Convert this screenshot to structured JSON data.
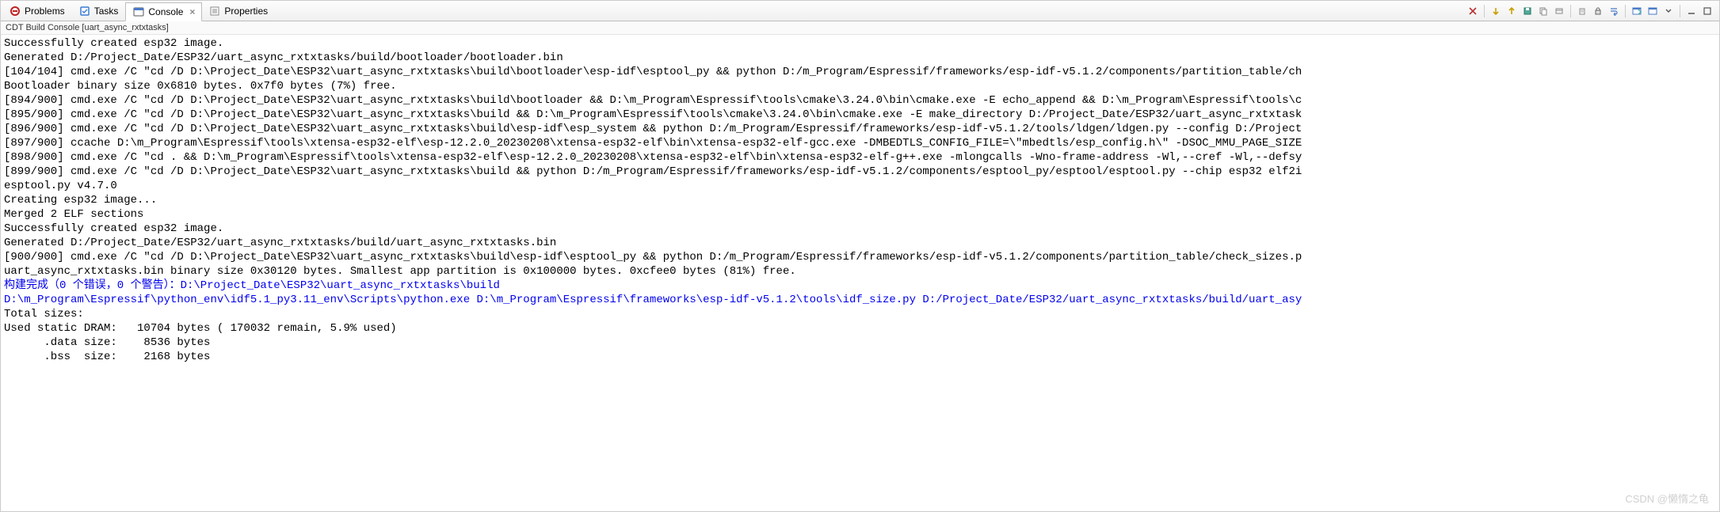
{
  "tabs": {
    "problems": "Problems",
    "tasks": "Tasks",
    "console": "Console",
    "properties": "Properties"
  },
  "subtitle": "CDT Build Console [uart_async_rxtxtasks]",
  "toolbar": {
    "close": "×",
    "arrow_down": "⇩",
    "arrow_up": "⇧",
    "pin": "📌",
    "sync": "🔄",
    "clear": "🧹",
    "scroll_lock": "🔒",
    "wrap": "↩",
    "open": "📂",
    "terminal": "🖥",
    "new": "➕",
    "dropdown": "▾",
    "min": "—",
    "max": "▢"
  },
  "console_lines": [
    {
      "t": "Successfully created esp32 image.",
      "c": ""
    },
    {
      "t": "Generated D:/Project_Date/ESP32/uart_async_rxtxtasks/build/bootloader/bootloader.bin",
      "c": ""
    },
    {
      "t": "[104/104] cmd.exe /C \"cd /D D:\\Project_Date\\ESP32\\uart_async_rxtxtasks\\build\\bootloader\\esp-idf\\esptool_py && python D:/m_Program/Espressif/frameworks/esp-idf-v5.1.2/components/partition_table/ch",
      "c": ""
    },
    {
      "t": "Bootloader binary size 0x6810 bytes. 0x7f0 bytes (7%) free.",
      "c": ""
    },
    {
      "t": "[894/900] cmd.exe /C \"cd /D D:\\Project_Date\\ESP32\\uart_async_rxtxtasks\\build\\bootloader && D:\\m_Program\\Espressif\\tools\\cmake\\3.24.0\\bin\\cmake.exe -E echo_append && D:\\m_Program\\Espressif\\tools\\c",
      "c": ""
    },
    {
      "t": "[895/900] cmd.exe /C \"cd /D D:\\Project_Date\\ESP32\\uart_async_rxtxtasks\\build && D:\\m_Program\\Espressif\\tools\\cmake\\3.24.0\\bin\\cmake.exe -E make_directory D:/Project_Date/ESP32/uart_async_rxtxtask",
      "c": ""
    },
    {
      "t": "[896/900] cmd.exe /C \"cd /D D:\\Project_Date\\ESP32\\uart_async_rxtxtasks\\build\\esp-idf\\esp_system && python D:/m_Program/Espressif/frameworks/esp-idf-v5.1.2/tools/ldgen/ldgen.py --config D:/Project",
      "c": ""
    },
    {
      "t": "[897/900] ccache D:\\m_Program\\Espressif\\tools\\xtensa-esp32-elf\\esp-12.2.0_20230208\\xtensa-esp32-elf\\bin\\xtensa-esp32-elf-gcc.exe -DMBEDTLS_CONFIG_FILE=\\\"mbedtls/esp_config.h\\\" -DSOC_MMU_PAGE_SIZE",
      "c": ""
    },
    {
      "t": "[898/900] cmd.exe /C \"cd . && D:\\m_Program\\Espressif\\tools\\xtensa-esp32-elf\\esp-12.2.0_20230208\\xtensa-esp32-elf\\bin\\xtensa-esp32-elf-g++.exe -mlongcalls -Wno-frame-address -Wl,--cref -Wl,--defsy",
      "c": ""
    },
    {
      "t": "[899/900] cmd.exe /C \"cd /D D:\\Project_Date\\ESP32\\uart_async_rxtxtasks\\build && python D:/m_Program/Espressif/frameworks/esp-idf-v5.1.2/components/esptool_py/esptool/esptool.py --chip esp32 elf2i",
      "c": ""
    },
    {
      "t": "esptool.py v4.7.0",
      "c": ""
    },
    {
      "t": "Creating esp32 image...",
      "c": ""
    },
    {
      "t": "Merged 2 ELF sections",
      "c": ""
    },
    {
      "t": "Successfully created esp32 image.",
      "c": ""
    },
    {
      "t": "Generated D:/Project_Date/ESP32/uart_async_rxtxtasks/build/uart_async_rxtxtasks.bin",
      "c": ""
    },
    {
      "t": "[900/900] cmd.exe /C \"cd /D D:\\Project_Date\\ESP32\\uart_async_rxtxtasks\\build\\esp-idf\\esptool_py && python D:/m_Program/Espressif/frameworks/esp-idf-v5.1.2/components/partition_table/check_sizes.p",
      "c": ""
    },
    {
      "t": "uart_async_rxtxtasks.bin binary size 0x30120 bytes. Smallest app partition is 0x100000 bytes. 0xcfee0 bytes (81%) free.",
      "c": ""
    },
    {
      "t": "构建完成（0 个错误，0 个警告）：D:\\Project_Date\\ESP32\\uart_async_rxtxtasks\\build",
      "c": "blue"
    },
    {
      "t": "D:\\m_Program\\Espressif\\python_env\\idf5.1_py3.11_env\\Scripts\\python.exe D:\\m_Program\\Espressif\\frameworks\\esp-idf-v5.1.2\\tools\\idf_size.py D:/Project_Date/ESP32/uart_async_rxtxtasks/build/uart_asy",
      "c": "blue"
    },
    {
      "t": "Total sizes:",
      "c": ""
    },
    {
      "t": "",
      "c": ""
    },
    {
      "t": "Used static DRAM:   10704 bytes ( 170032 remain, 5.9% used)",
      "c": ""
    },
    {
      "t": "",
      "c": ""
    },
    {
      "t": "      .data size:    8536 bytes",
      "c": ""
    },
    {
      "t": "",
      "c": ""
    },
    {
      "t": "      .bss  size:    2168 bytes",
      "c": ""
    }
  ],
  "watermark": "CSDN @懒惰之龟"
}
